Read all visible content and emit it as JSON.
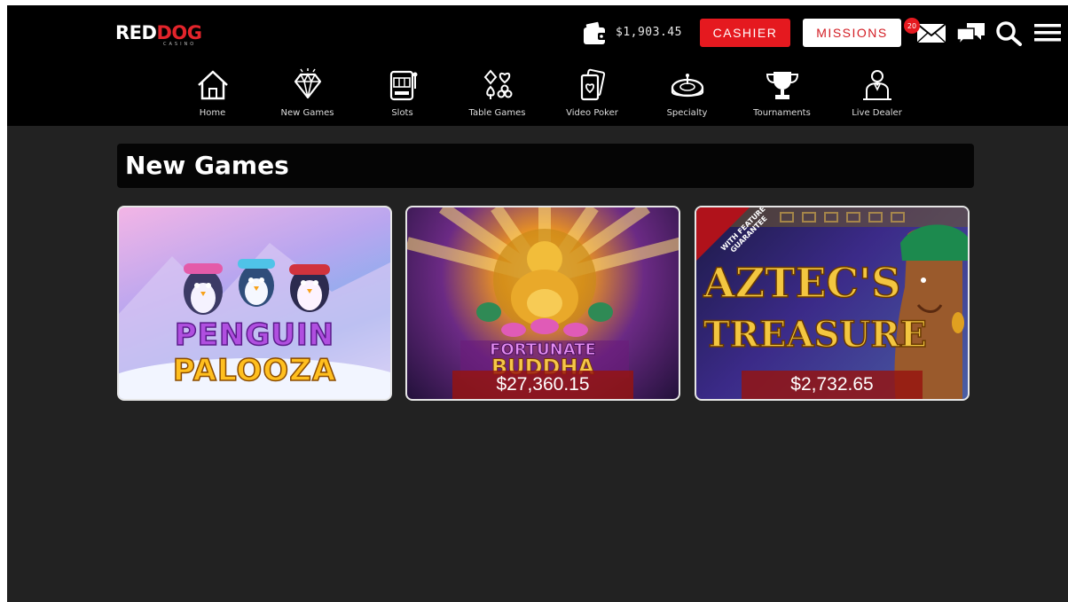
{
  "brand": {
    "logo_red": "RED",
    "logo_dog": "DOG",
    "logo_sub": "CASINO"
  },
  "header": {
    "balance": "$1,903.45",
    "cashier_label": "CASHIER",
    "missions_label": "MISSIONS",
    "mail_badge_count": "20"
  },
  "nav": {
    "items": [
      {
        "label": "Home",
        "icon": "home-icon"
      },
      {
        "label": "New Games",
        "icon": "diamond-icon"
      },
      {
        "label": "Slots",
        "icon": "slot-machine-icon"
      },
      {
        "label": "Table Games",
        "icon": "card-suits-icon"
      },
      {
        "label": "Video Poker",
        "icon": "playing-card-icon"
      },
      {
        "label": "Specialty",
        "icon": "roulette-icon"
      },
      {
        "label": "Tournaments",
        "icon": "trophy-icon"
      },
      {
        "label": "Live Dealer",
        "icon": "dealer-icon"
      }
    ]
  },
  "main": {
    "section_title": "New Games",
    "games": [
      {
        "art_line1": "PENGUIN",
        "art_line2": "PALOOZA",
        "jackpot": null
      },
      {
        "art_line1": "FORTUNATE",
        "art_line2": "BUDDHA",
        "jackpot": "$27,360.15"
      },
      {
        "art_line1": "AZTEC'S",
        "art_line2": "TREASURE",
        "art_badge": "WITH FEATURE GUARANTEE",
        "jackpot": "$2,732.65"
      }
    ]
  },
  "colors": {
    "accent_red": "#e5191f",
    "header_bg": "#000000",
    "page_bg": "#222222"
  }
}
